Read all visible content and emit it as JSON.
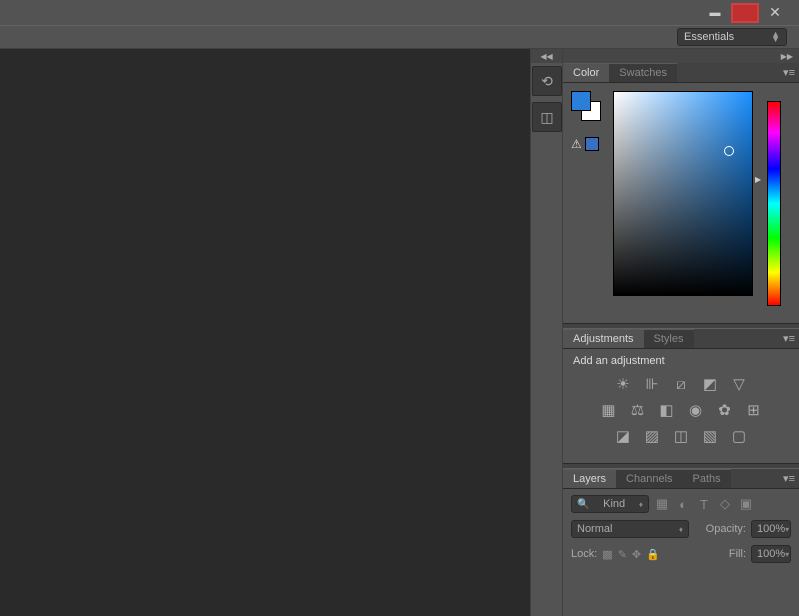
{
  "workspace": {
    "selected": "Essentials"
  },
  "colorPanel": {
    "tabs": [
      "Color",
      "Swatches"
    ],
    "activeTab": 0,
    "foreground": "#2a7fd8",
    "background": "#ffffff",
    "warnSwatch": "#3a6fbf"
  },
  "adjustmentsPanel": {
    "tabs": [
      "Adjustments",
      "Styles"
    ],
    "activeTab": 0,
    "heading": "Add an adjustment"
  },
  "layersPanel": {
    "tabs": [
      "Layers",
      "Channels",
      "Paths"
    ],
    "activeTab": 0,
    "filterKind": "Kind",
    "blendMode": "Normal",
    "opacityLabel": "Opacity:",
    "opacityValue": "100%",
    "lockLabel": "Lock:",
    "fillLabel": "Fill:",
    "fillValue": "100%"
  }
}
